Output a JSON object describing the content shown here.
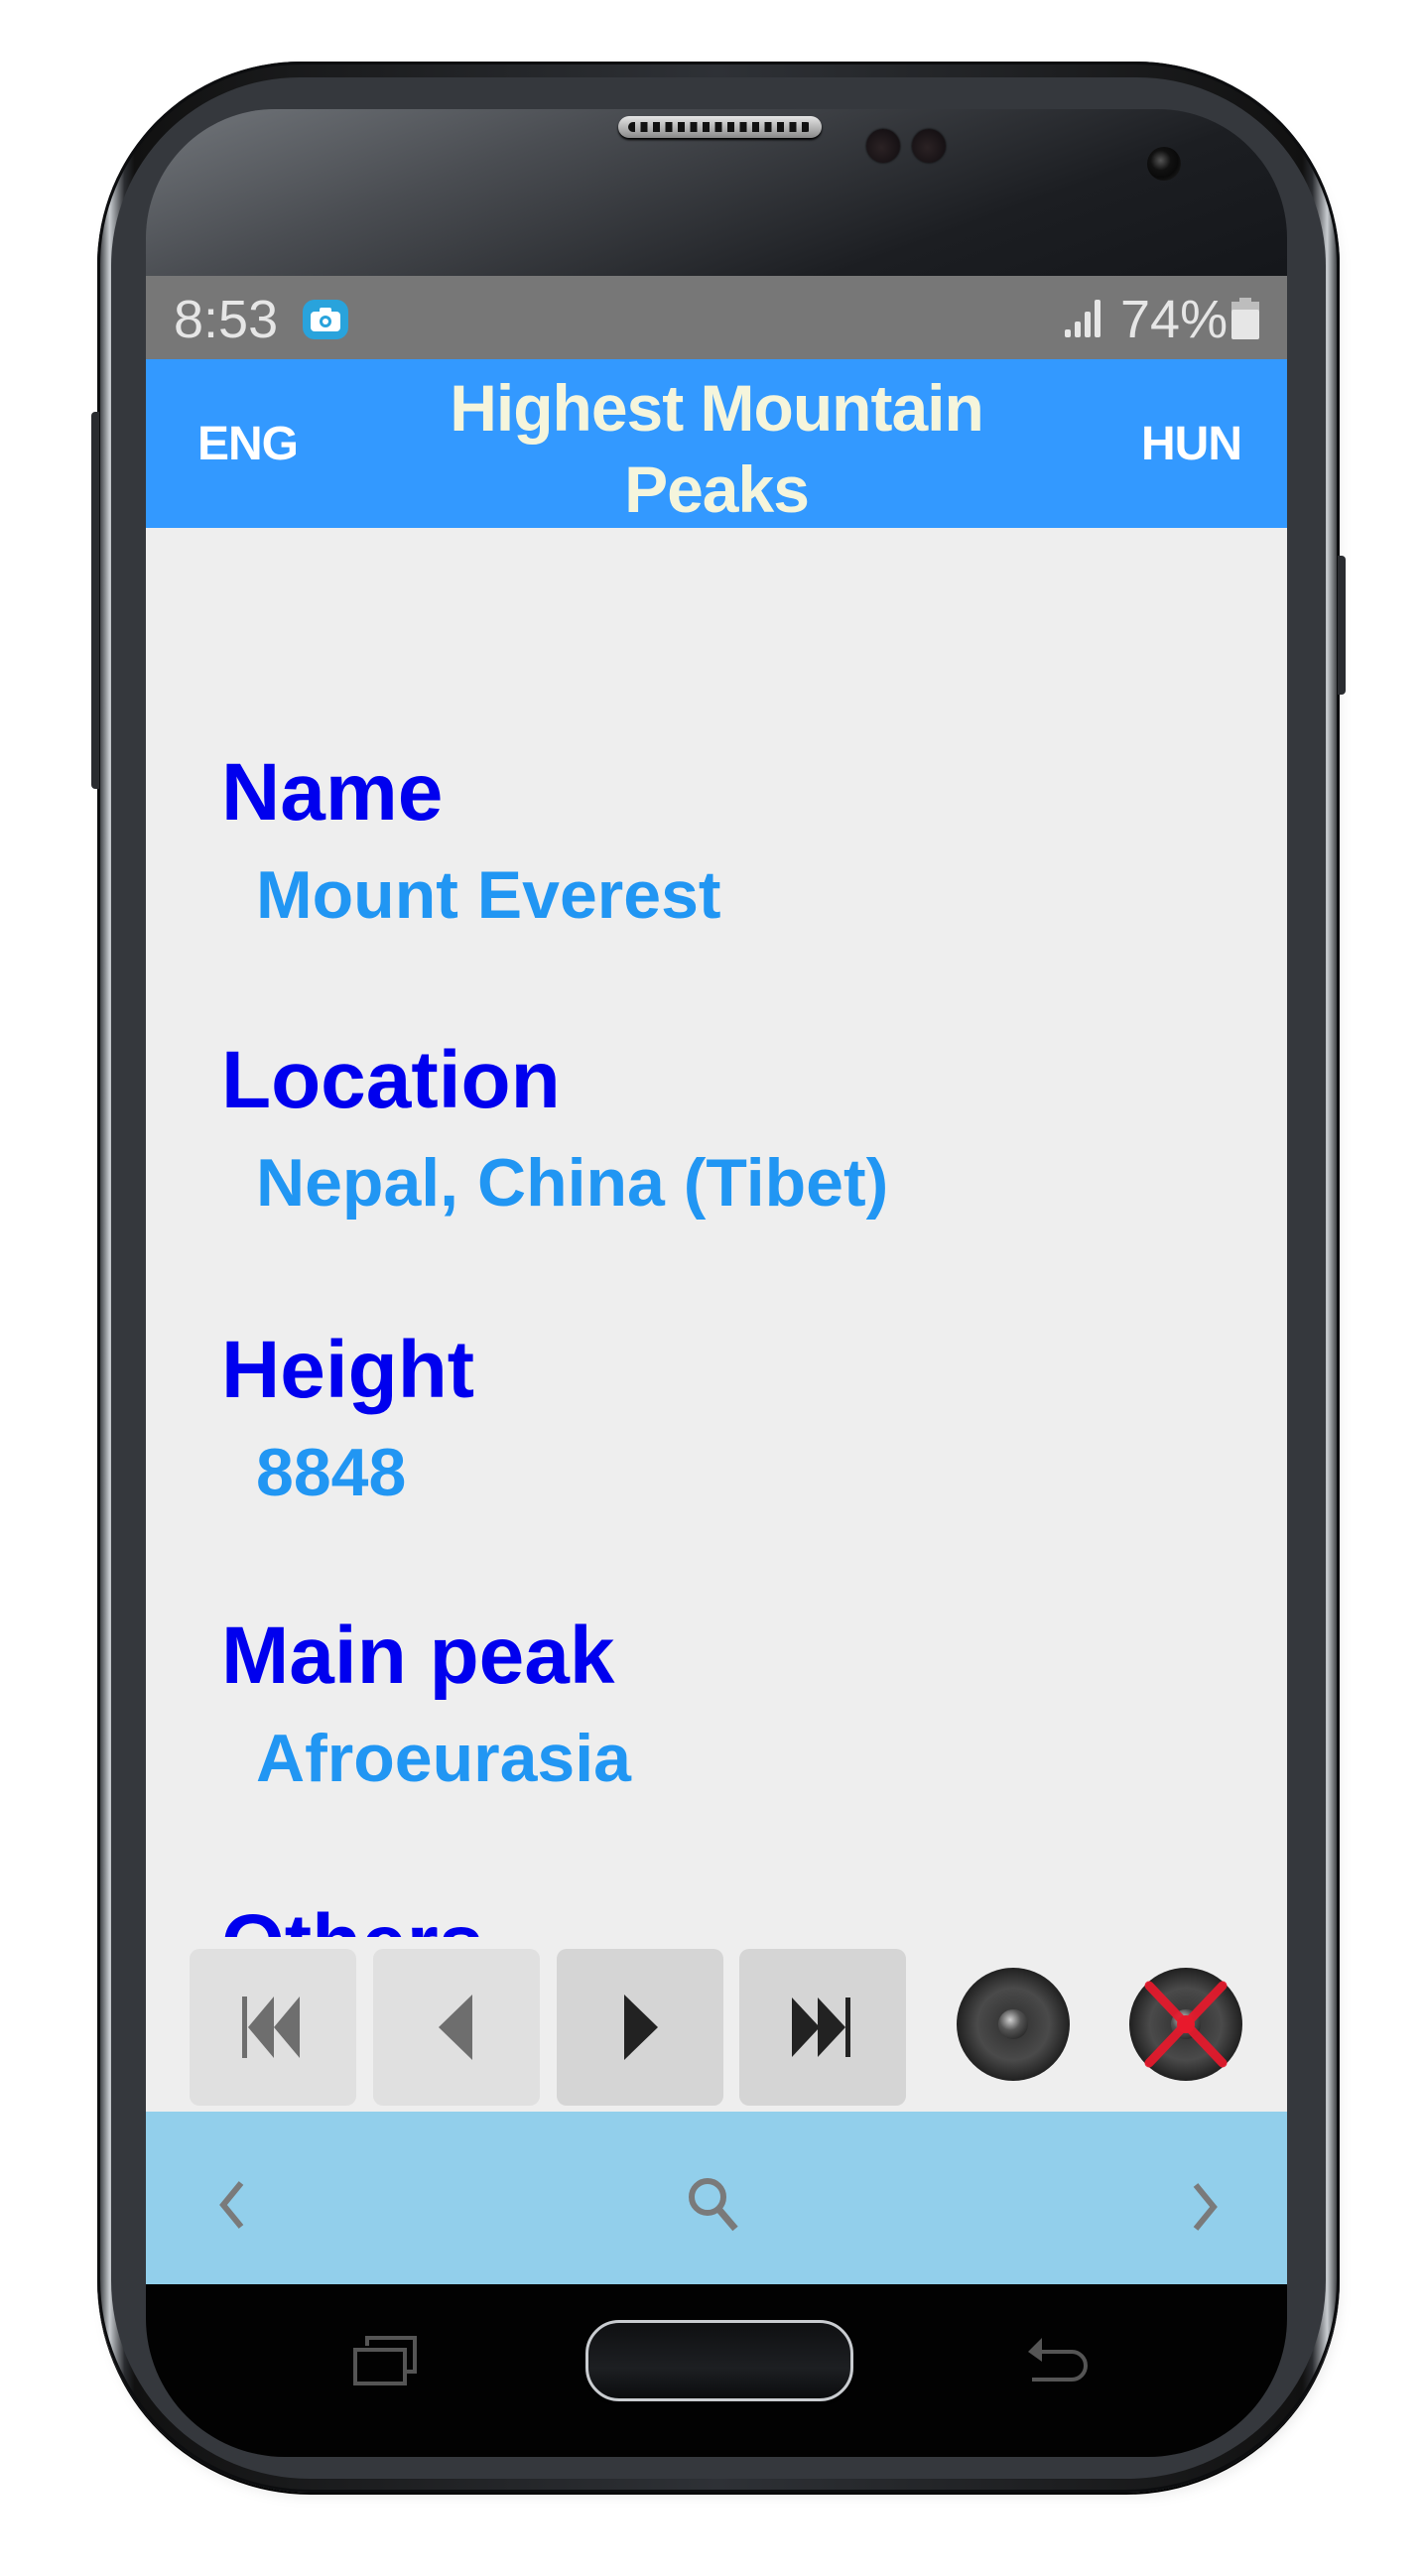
{
  "status_bar": {
    "time": "8:53",
    "notification_icon": "screenshot-camera-icon",
    "signal_icon": "signal-bars-icon",
    "battery_percent": "74%",
    "battery_icon": "battery-icon"
  },
  "app_bar": {
    "title": "Highest Mountain Peaks",
    "lang_left": "ENG",
    "lang_right": "HUN"
  },
  "fields": [
    {
      "label": "Name",
      "value": "Mount Everest"
    },
    {
      "label": "Location",
      "value": "Nepal, China (Tibet)"
    },
    {
      "label": "Height",
      "value": "8848"
    },
    {
      "label": "Main peak",
      "value": "Afroeurasia"
    },
    {
      "label": "Others",
      "value": ""
    }
  ],
  "media_controls": {
    "buttons": [
      {
        "icon": "skip-to-first-icon",
        "enabled": false
      },
      {
        "icon": "previous-icon",
        "enabled": false
      },
      {
        "icon": "play-next-icon",
        "enabled": true
      },
      {
        "icon": "skip-to-last-icon",
        "enabled": true
      }
    ],
    "sound_on_icon": "speaker-icon",
    "sound_off_icon": "speaker-muted-icon"
  },
  "bottom_nav": {
    "left_icon": "chevron-left-icon",
    "center_icon": "search-icon",
    "right_icon": "chevron-right-icon"
  },
  "colors": {
    "app_bar": "#3399ff",
    "title": "#f5f5dc",
    "label": "#0000ee",
    "value": "#2196f3",
    "nav_bar": "#92cfeb",
    "status_bar": "#777777"
  }
}
